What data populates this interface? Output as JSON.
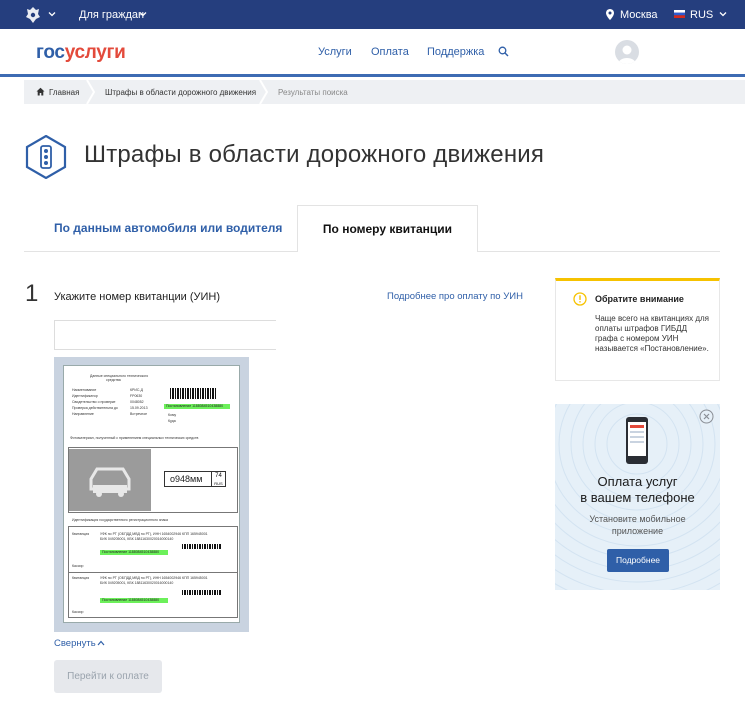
{
  "topbar": {
    "audience": "Для граждан",
    "location": "Москва",
    "language": "RUS"
  },
  "header": {
    "logo_part1": "гос",
    "logo_part2": "услуги",
    "nav": [
      "Услуги",
      "Оплата",
      "Поддержка"
    ]
  },
  "breadcrumbs": {
    "home": "Главная",
    "section": "Штрафы в области дорожного движения",
    "current": "Результаты поиска"
  },
  "page": {
    "title": "Штрафы в области дорожного движения"
  },
  "tabs": {
    "by_vehicle": "По данным автомобиля или водителя",
    "by_receipt": "По номеру квитанции"
  },
  "step": {
    "number": "1",
    "label": "Укажите номер квитанции (УИН)",
    "more_link": "Подробнее про оплату по УИН",
    "input_value": "",
    "collapse": "Свернуть",
    "pay_button": "Перейти к оплате"
  },
  "receipt": {
    "plate_number": "о948мм",
    "plate_region": "74",
    "plate_country": "RUS"
  },
  "notice": {
    "title": "Обратите внимание",
    "text": "Чаще всего на квитанциях для оплаты штрафов ГИБДД графа с номером УИН называется «Постановление»."
  },
  "promo": {
    "title_line1": "Оплата услуг",
    "title_line2": "в вашем телефоне",
    "subtitle_line1": "Установите мобильное",
    "subtitle_line2": "приложение",
    "button": "Подробнее"
  },
  "colors": {
    "topbar": "#253e7e",
    "link": "#2f5fa8",
    "logo_red": "#e34a3b",
    "notice_accent": "#f6c200",
    "highlight_green": "#6cf05a"
  }
}
